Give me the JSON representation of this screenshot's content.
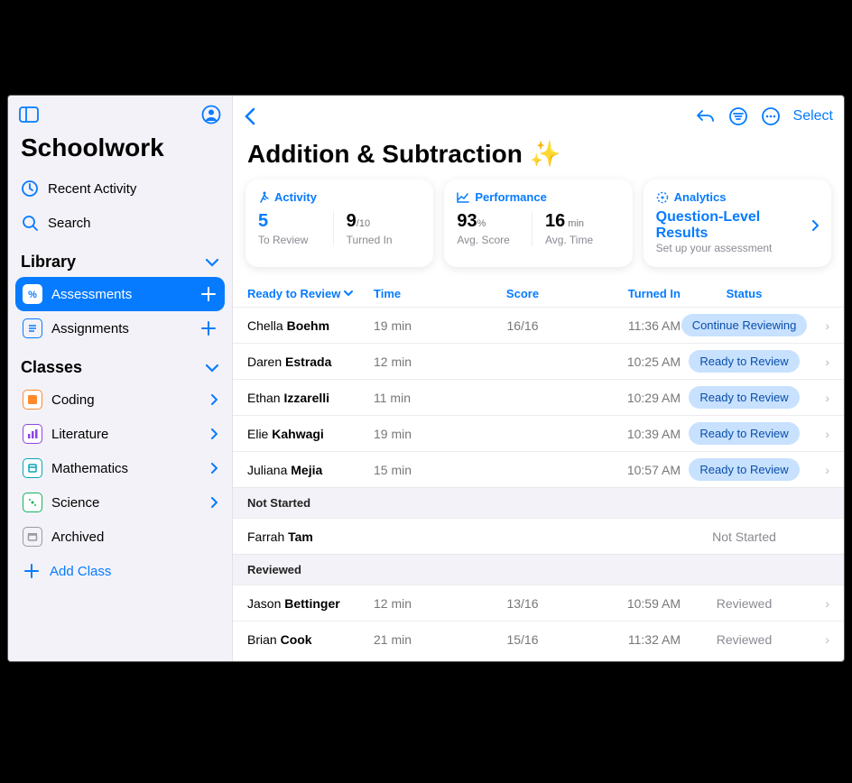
{
  "sidebar": {
    "appTitle": "Schoolwork",
    "recent": "Recent Activity",
    "search": "Search",
    "libraryHeader": "Library",
    "assessments": "Assessments",
    "assignments": "Assignments",
    "classesHeader": "Classes",
    "classes": {
      "coding": "Coding",
      "literature": "Literature",
      "mathematics": "Mathematics",
      "science": "Science",
      "archived": "Archived"
    },
    "addClass": "Add Class"
  },
  "toolbar": {
    "select": "Select"
  },
  "page": {
    "title": "Addition & Subtraction ✨"
  },
  "cards": {
    "activity": {
      "header": "Activity",
      "toReviewValue": "5",
      "toReviewLabel": "To Review",
      "turnedInValue": "9",
      "turnedInDen": "/10",
      "turnedInLabel": "Turned In"
    },
    "performance": {
      "header": "Performance",
      "avgScoreValue": "93",
      "avgScorePct": "%",
      "avgScoreLabel": "Avg. Score",
      "avgTimeValue": "16",
      "avgTimeUnit": " min",
      "avgTimeLabel": "Avg. Time"
    },
    "analytics": {
      "header": "Analytics",
      "title": "Question-Level Results",
      "sub": "Set up your assessment"
    }
  },
  "table": {
    "headers": {
      "ready": "Ready to Review",
      "time": "Time",
      "score": "Score",
      "turned": "Turned In",
      "status": "Status"
    },
    "sections": {
      "notStarted": "Not Started",
      "reviewed": "Reviewed"
    },
    "rows": {
      "r0": {
        "first": "Chella",
        "last": "Boehm",
        "time": "19 min",
        "score": "16/16",
        "turn": "11:36 AM",
        "status": "Continue Reviewing"
      },
      "r1": {
        "first": "Daren",
        "last": "Estrada",
        "time": "12 min",
        "score": "",
        "turn": "10:25 AM",
        "status": "Ready to Review"
      },
      "r2": {
        "first": "Ethan",
        "last": "Izzarelli",
        "time": "11 min",
        "score": "",
        "turn": "10:29 AM",
        "status": "Ready to Review"
      },
      "r3": {
        "first": "Elie",
        "last": "Kahwagi",
        "time": "19 min",
        "score": "",
        "turn": "10:39 AM",
        "status": "Ready to Review"
      },
      "r4": {
        "first": "Juliana",
        "last": "Mejia",
        "time": "15 min",
        "score": "",
        "turn": "10:57 AM",
        "status": "Ready to Review"
      },
      "ns0": {
        "first": "Farrah",
        "last": "Tam",
        "status": "Not Started"
      },
      "rv0": {
        "first": "Jason",
        "last": "Bettinger",
        "time": "12 min",
        "score": "13/16",
        "turn": "10:59 AM",
        "status": "Reviewed"
      },
      "rv1": {
        "first": "Brian",
        "last": "Cook",
        "time": "21 min",
        "score": "15/16",
        "turn": "11:32 AM",
        "status": "Reviewed"
      }
    }
  }
}
